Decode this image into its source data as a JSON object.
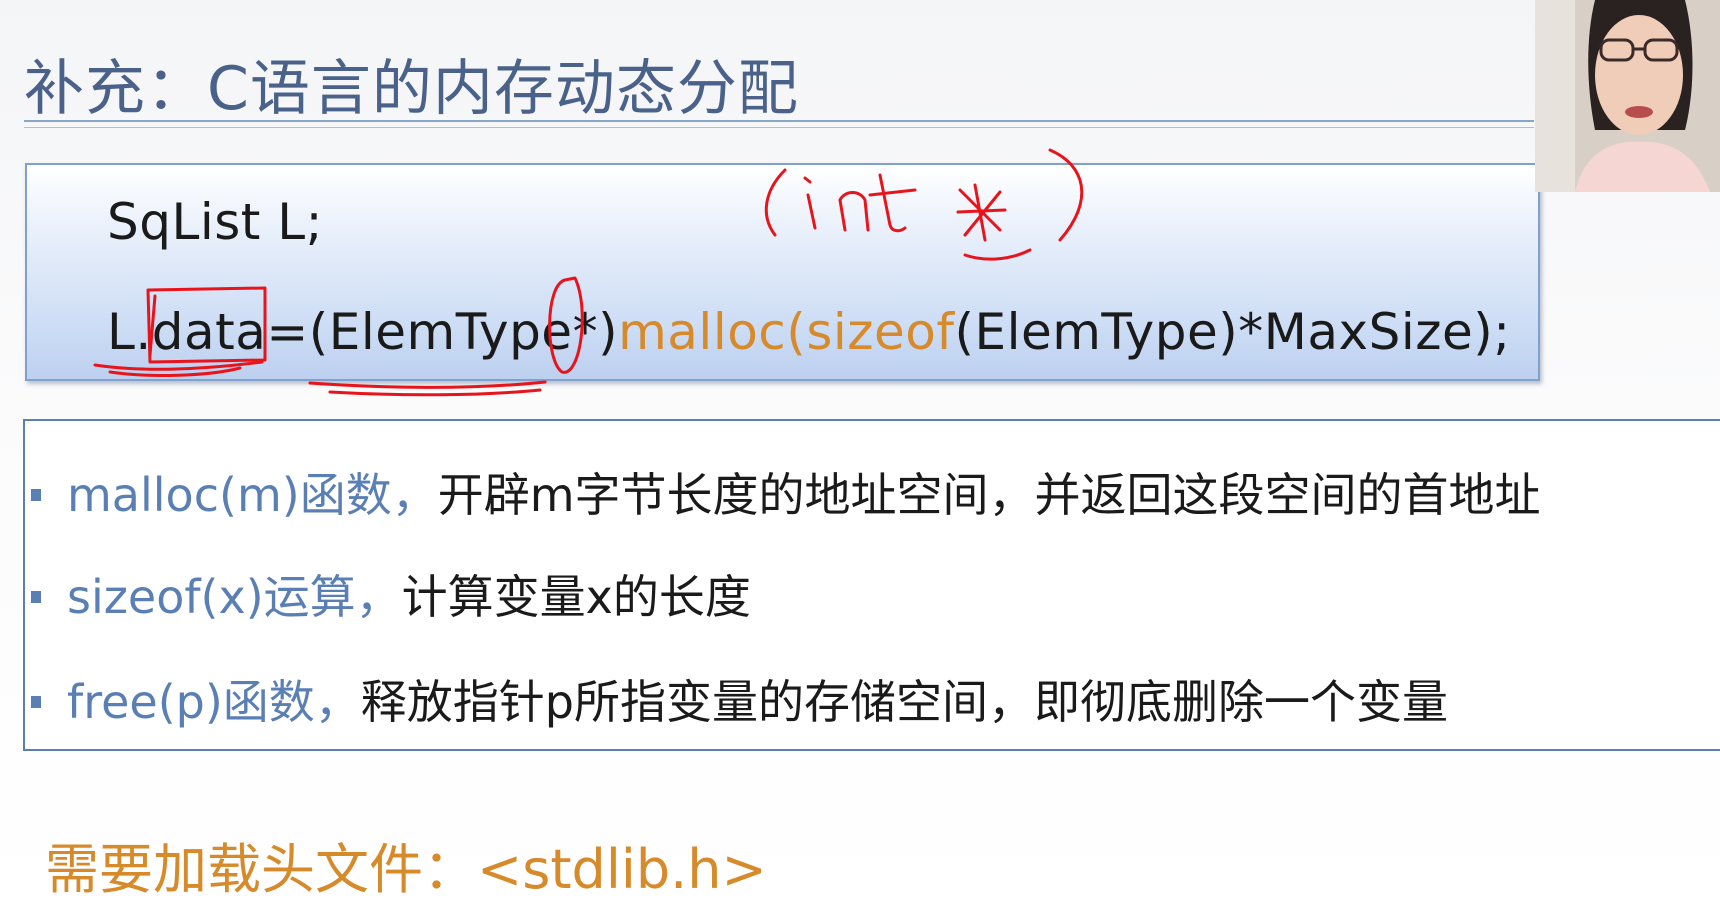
{
  "slide": {
    "title": "补充：C语言的内存动态分配",
    "code": {
      "line1": "SqList L;",
      "line2_prefix": "L.data=(ElemType*)",
      "line2_fn": "malloc",
      "line2_paren": "(",
      "line2_sizeof": "sizeof",
      "line2_suffix": "(ElemType)*MaxSize);"
    },
    "bullets": [
      {
        "term": "malloc(m)函数，",
        "desc": "开辟m字节长度的地址空间，并返回这段空间的首地址"
      },
      {
        "term": "sizeof(x)运算，",
        "desc": "计算变量x的长度"
      },
      {
        "term": "free(p)函数，",
        "desc": "释放指针p所指变量的存储空间，即彻底删除一个变量"
      }
    ],
    "footer_note": "需要加载头文件：<stdlib.h>"
  },
  "colors": {
    "title": "#4a6289",
    "accent_blue": "#5a7fb4",
    "accent_orange": "#d68a2a",
    "annotation_red": "#e8141c"
  },
  "overlay": {
    "handwritten_note": "(int *)",
    "webcam": "presenter-video"
  }
}
